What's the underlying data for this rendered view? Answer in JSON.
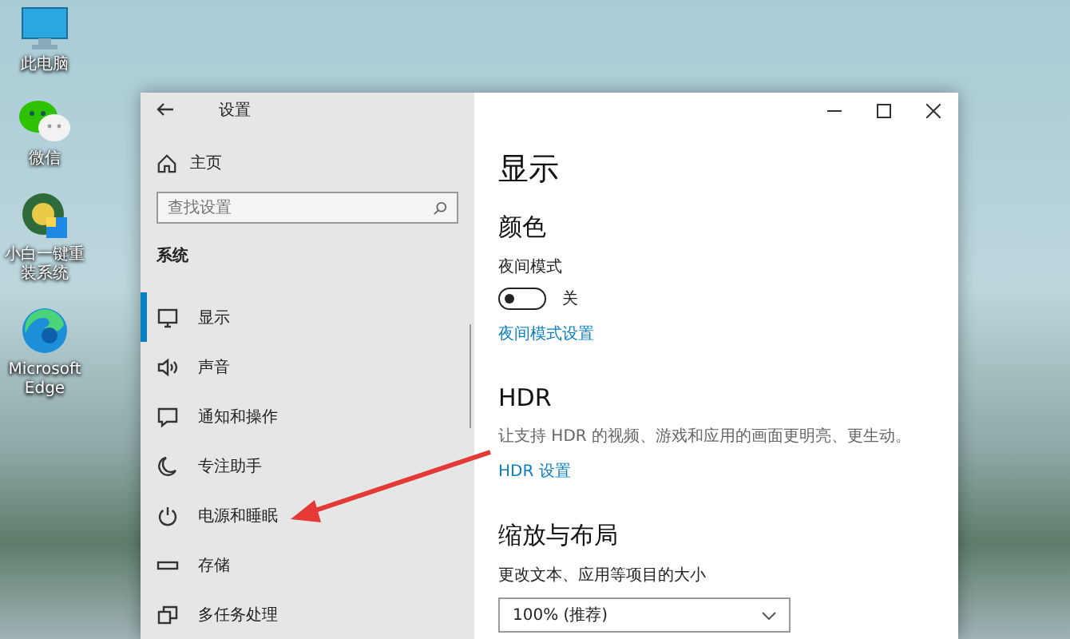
{
  "desktop": {
    "icons": [
      {
        "label": "此电脑",
        "kind": "pc"
      },
      {
        "label": "微信",
        "kind": "chat"
      },
      {
        "label": "小白一键重装系统",
        "kind": "installer"
      },
      {
        "label": "Microsoft Edge",
        "kind": "browser"
      }
    ]
  },
  "window": {
    "title": "设置",
    "home": "主页",
    "search": {
      "placeholder": "查找设置"
    },
    "section": "系统",
    "nav": [
      {
        "label": "显示",
        "kind": "monitor",
        "selected": true
      },
      {
        "label": "声音",
        "kind": "speaker",
        "selected": false
      },
      {
        "label": "通知和操作",
        "kind": "message",
        "selected": false
      },
      {
        "label": "专注助手",
        "kind": "moon",
        "selected": false
      },
      {
        "label": "电源和睡眠",
        "kind": "power",
        "selected": false
      },
      {
        "label": "存储",
        "kind": "storage",
        "selected": false
      },
      {
        "label": "多任务处理",
        "kind": "multitask",
        "selected": false
      }
    ]
  },
  "content": {
    "heading": "显示",
    "color_section": {
      "title": "颜色",
      "night_mode": {
        "label": "夜间模式",
        "on": false,
        "state_text": "关"
      },
      "link": "夜间模式设置"
    },
    "hdr_section": {
      "title": "HDR",
      "description": "让支持 HDR 的视频、游戏和应用的画面更明亮、更生动。",
      "link": "HDR 设置"
    },
    "scale_section": {
      "title": "缩放与布局",
      "label": "更改文本、应用等项目的大小",
      "dropdown": {
        "value": "100% (推荐)"
      }
    }
  }
}
